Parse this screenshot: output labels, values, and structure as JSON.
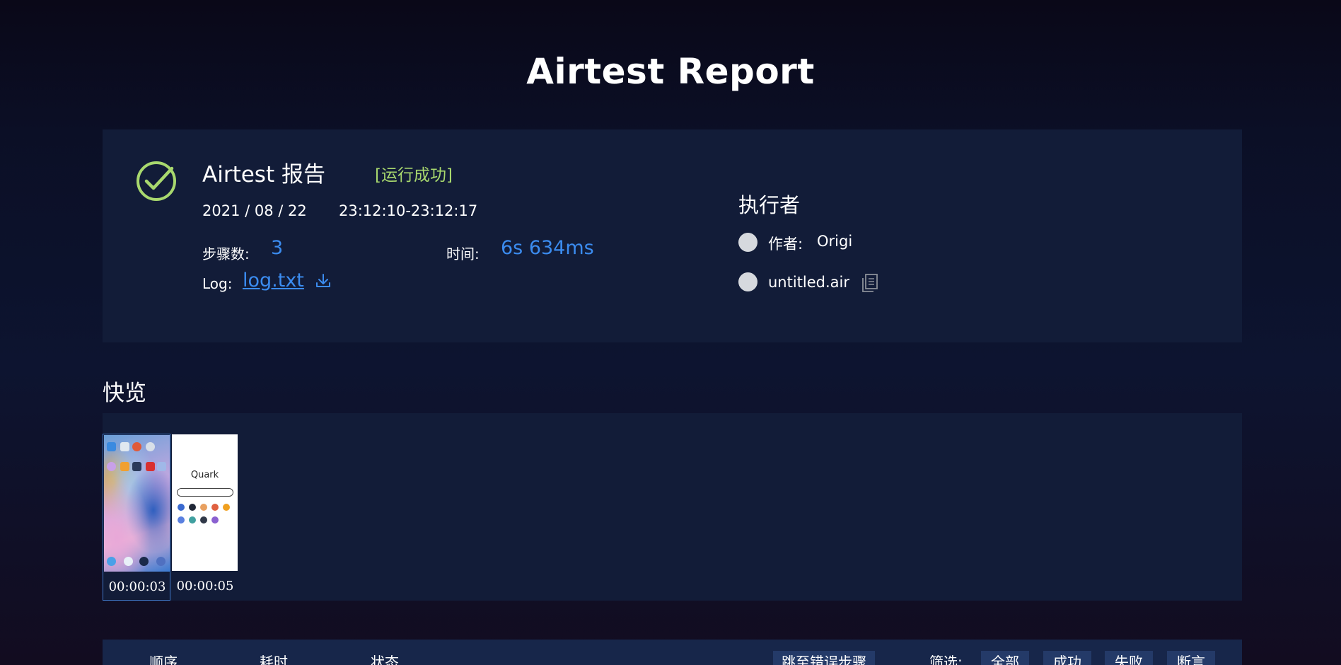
{
  "page": {
    "title": "Airtest Report"
  },
  "summary": {
    "report_title": "Airtest 报告",
    "run_status": "[运行成功]",
    "date": "2021 / 08 / 22",
    "time_range": "23:12:10-23:12:17",
    "steps_label": "步骤数:",
    "steps_value": "3",
    "duration_label": "时间:",
    "duration_value": "6s 634ms",
    "log_label": "Log:",
    "log_link": "log.txt",
    "status_color": "#a8d86e",
    "accent_color": "#3b8cf0"
  },
  "executor": {
    "title": "执行者",
    "author_label": "作者:",
    "author_value": "Origi",
    "script_name": "untitled.air"
  },
  "overview": {
    "title": "快览",
    "thumbnails": [
      {
        "time": "00:00:03",
        "active": true
      },
      {
        "time": "00:00:05",
        "active": false
      }
    ],
    "quark_logo": "Quark"
  },
  "table": {
    "headers": {
      "order": "顺序",
      "time": "耗时",
      "status": "状态"
    },
    "jump_button": "跳至错误步骤",
    "filter_label": "筛选:",
    "filters": [
      "全部",
      "成功",
      "失败",
      "断言"
    ]
  }
}
